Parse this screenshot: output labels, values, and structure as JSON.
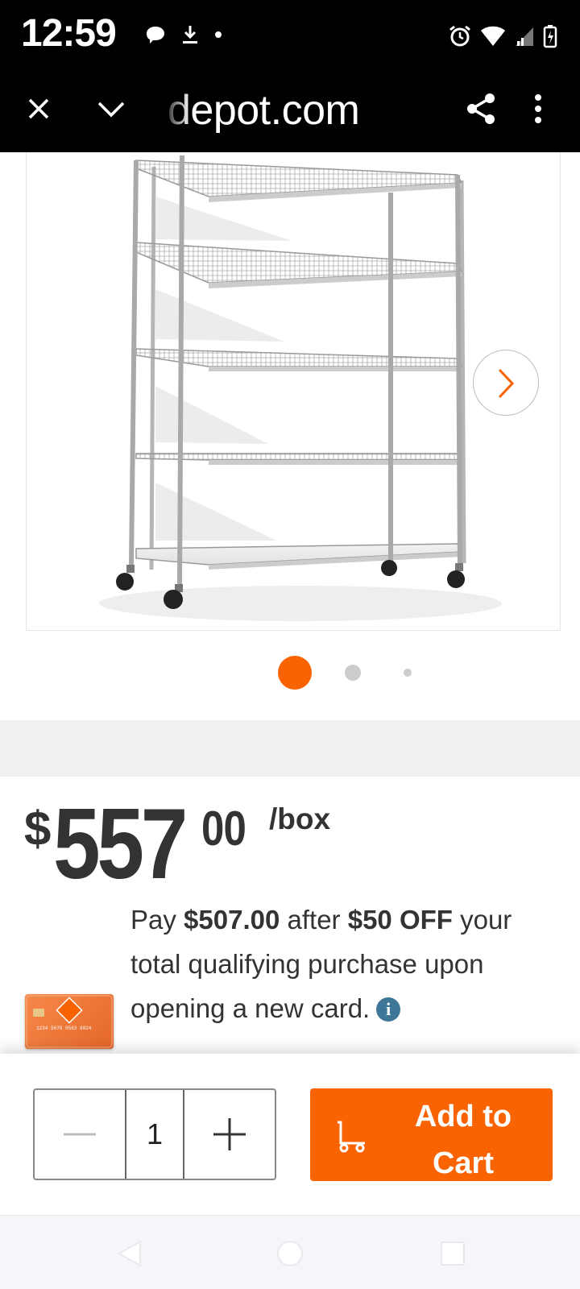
{
  "status_bar": {
    "time": "12:59",
    "left_icons": [
      "chat-bubble-icon",
      "download-icon",
      "dot-icon"
    ],
    "right_icons": [
      "alarm-icon",
      "wifi-icon",
      "signal-icon",
      "battery-icon"
    ]
  },
  "browser": {
    "url": "depot.com",
    "close_icon": "close-icon",
    "collapse_icon": "chevron-down-icon",
    "share_icon": "share-icon",
    "menu_icon": "more-vert-icon"
  },
  "gallery": {
    "image_alt": "5-tier wire shelving rack on casters",
    "next_icon": "chevron-right-icon",
    "page_count": 3,
    "active_index": 0
  },
  "price": {
    "currency": "$",
    "dollars": "557",
    "cents": "00",
    "unit": "/box"
  },
  "promo": {
    "pay_prefix": "Pay ",
    "pay_amount": "$507.00",
    "after_text": " after ",
    "discount": "$50 OFF",
    "rest": " your total qualifying purchase upon opening a new card.",
    "card_number": "1234 5678 0563 9024",
    "card_brand": "THE HOME DEPOT"
  },
  "cart": {
    "quantity": "1",
    "minus_icon": "minus-icon",
    "plus_icon": "plus-icon",
    "add_label": "Add to\nCart",
    "cart_icon": "cart-icon"
  },
  "colors": {
    "brand_orange": "#f96302",
    "info_blue": "#3e7697",
    "text_dark": "#333333"
  },
  "nav": {
    "back_icon": "back-icon",
    "home_icon": "home-icon",
    "recents_icon": "recents-icon"
  }
}
